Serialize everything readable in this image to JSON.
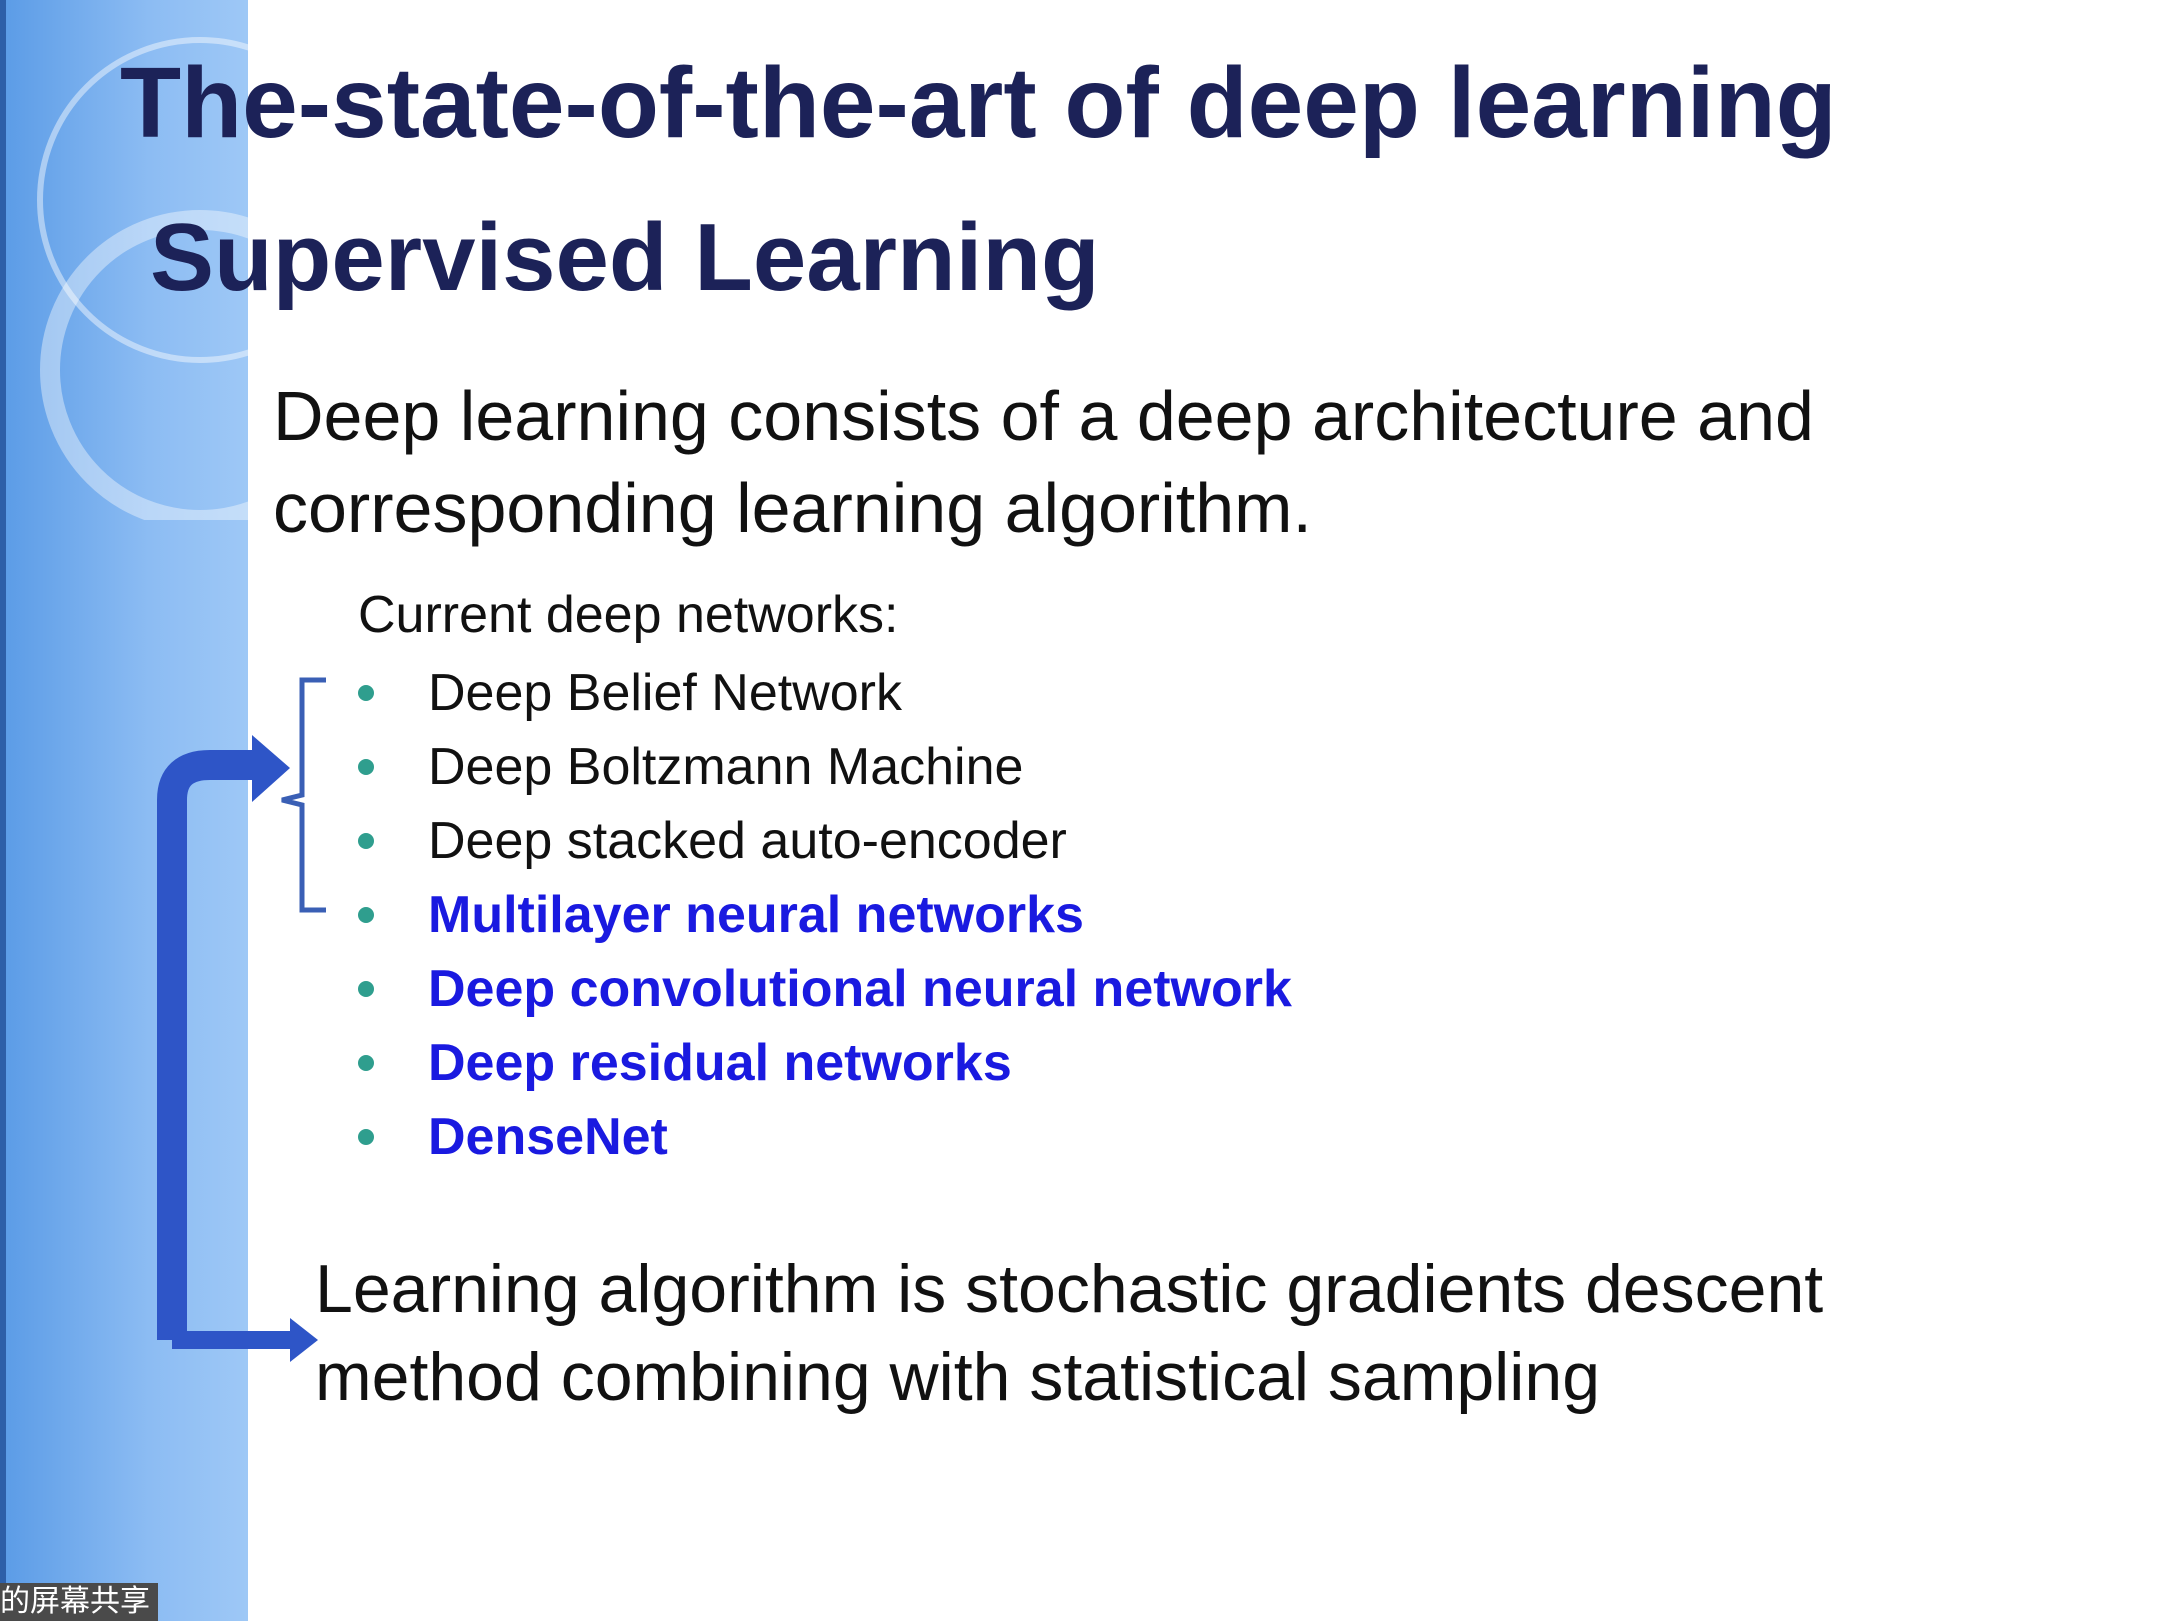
{
  "slide": {
    "title": "The-state-of-the-art of deep learning",
    "subtitle": "Supervised Learning",
    "intro": "Deep learning consists of a deep architecture and corresponding learning algorithm.",
    "list_heading": "Current deep networks:",
    "networks": [
      {
        "label": "Deep Belief Network",
        "highlight": false
      },
      {
        "label": "Deep Boltzmann Machine",
        "highlight": false
      },
      {
        "label": "Deep stacked auto-encoder",
        "highlight": false
      },
      {
        "label": "Multilayer neural networks",
        "highlight": true
      },
      {
        "label": "Deep convolutional neural network",
        "highlight": true
      },
      {
        "label": "Deep residual networks",
        "highlight": true
      },
      {
        "label": "DenseNet",
        "highlight": true
      }
    ],
    "footer": "Learning algorithm is stochastic gradients descent method combining with statistical sampling"
  },
  "overlay": {
    "watermark": "的屏幕共享"
  },
  "colors": {
    "title": "#1c2258",
    "highlight": "#1a1ae0",
    "bullet": "#2f9e8e",
    "arrow": "#2e55c7",
    "sidebar": "#8cbcf3"
  }
}
